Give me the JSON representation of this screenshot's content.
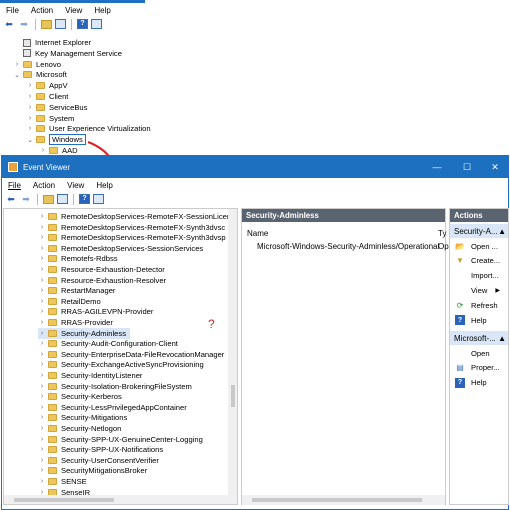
{
  "top_window": {
    "menu": [
      "File",
      "Action",
      "View",
      "Help"
    ],
    "tree": [
      {
        "label": "Internet Explorer",
        "type": "key",
        "indent": 0,
        "chev": ""
      },
      {
        "label": "Key Management Service",
        "type": "key",
        "indent": 0,
        "chev": ""
      },
      {
        "label": "Lenovo",
        "type": "folder",
        "indent": 0,
        "chev": ">"
      },
      {
        "label": "Microsoft",
        "type": "folder",
        "indent": 0,
        "chev": "v"
      },
      {
        "label": "AppV",
        "type": "folder",
        "indent": 1,
        "chev": ">"
      },
      {
        "label": "Client",
        "type": "folder",
        "indent": 1,
        "chev": ">"
      },
      {
        "label": "ServiceBus",
        "type": "folder",
        "indent": 1,
        "chev": ">"
      },
      {
        "label": "System",
        "type": "folder",
        "indent": 1,
        "chev": ">"
      },
      {
        "label": "User Experience Virtualization",
        "type": "folder",
        "indent": 1,
        "chev": ">"
      },
      {
        "label": "Windows",
        "type": "folder",
        "indent": 1,
        "chev": "v",
        "boxed": true
      },
      {
        "label": "AAD",
        "type": "folder",
        "indent": 2,
        "chev": ">"
      }
    ]
  },
  "event_viewer": {
    "title": "Event Viewer",
    "menu": [
      "File",
      "Action",
      "View",
      "Help"
    ],
    "tree_items": [
      "RemoteDesktopServices-RemoteFX-SessionLicensing",
      "RemoteDesktopServices-RemoteFX-Synth3dvsc",
      "RemoteDesktopServices-RemoteFX-Synth3dvsp",
      "RemoteDesktopServices-SessionServices",
      "Remotefs-Rdbss",
      "Resource-Exhaustion-Detector",
      "Resource-Exhaustion-Resolver",
      "RestartManager",
      "RetailDemo",
      "RRAS-AGILEVPN-Provider",
      "RRAS-Provider",
      "Security-Adminless",
      "Security-Audit-Configuration-Client",
      "Security-EnterpriseData-FileRevocationManager",
      "Security-ExchangeActiveSyncProvisioning",
      "Security-IdentityListener",
      "Security-Isolation-BrokeringFileSystem",
      "Security-Kerberos",
      "Security-LessPrivilegedAppContainer",
      "Security-Mitigations",
      "Security-Netlogon",
      "Security-SPP-UX-GenuineCenter-Logging",
      "Security-SPP-UX-Notifications",
      "Security-UserConsentVerifier",
      "SecurityMitigationsBroker",
      "SENSE",
      "SenseIR"
    ],
    "selected_index": 11,
    "middle": {
      "header": "Security-Adminless",
      "col_name": "Name",
      "col_type": "Ty",
      "row_name": "Microsoft-Windows-Security-Adminless/Operational",
      "row_type": "Op"
    },
    "actions": {
      "header": "Actions",
      "group1_title": "Security-A...",
      "group1": [
        {
          "label": "Open ...",
          "icon": "open-icon"
        },
        {
          "label": "Create...",
          "icon": "filter-icon"
        },
        {
          "label": "Import...",
          "icon": ""
        },
        {
          "label": "View",
          "icon": ""
        },
        {
          "label": "Refresh",
          "icon": "refresh-icon"
        },
        {
          "label": "Help",
          "icon": "help-icon"
        }
      ],
      "group2_title": "Microsoft-...",
      "group2": [
        {
          "label": "Open",
          "icon": ""
        },
        {
          "label": "Proper...",
          "icon": "properties-icon"
        },
        {
          "label": "Help",
          "icon": "help-icon"
        }
      ]
    },
    "annotation": "?"
  },
  "colors": {
    "accent": "#1d6fc0",
    "header": "#5a6470",
    "arrow": "#e02020"
  }
}
